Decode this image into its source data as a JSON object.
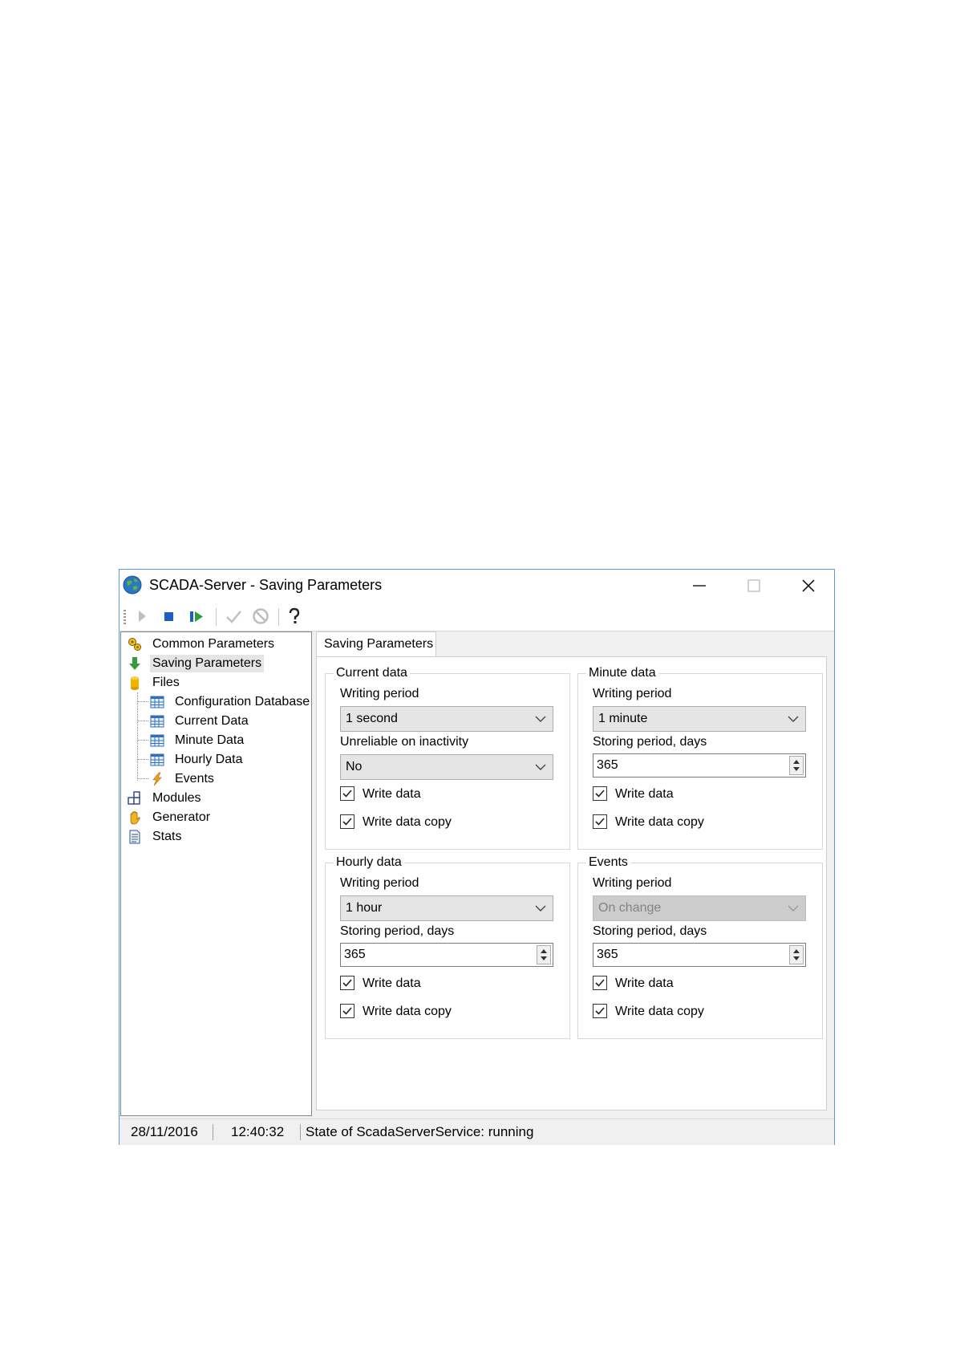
{
  "window": {
    "title": "SCADA-Server - Saving Parameters",
    "controls": {
      "minimize": "minimize-icon",
      "maximize": "maximize-icon",
      "close": "close-icon"
    }
  },
  "toolbar": {
    "buttons": [
      "start-icon",
      "stop-icon",
      "restart-icon",
      "apply-icon",
      "cancel-icon",
      "help-icon"
    ]
  },
  "tree": {
    "items": [
      {
        "label": "Common Parameters",
        "icon": "gears-icon"
      },
      {
        "label": "Saving Parameters",
        "icon": "download-arrow-icon",
        "selected": true
      },
      {
        "label": "Files",
        "icon": "database-icon"
      },
      {
        "label": "Configuration Database",
        "icon": "table-icon"
      },
      {
        "label": "Current Data",
        "icon": "table-icon"
      },
      {
        "label": "Minute Data",
        "icon": "table-icon"
      },
      {
        "label": "Hourly Data",
        "icon": "table-icon"
      },
      {
        "label": "Events",
        "icon": "lightning-icon"
      },
      {
        "label": "Modules",
        "icon": "modules-icon"
      },
      {
        "label": "Generator",
        "icon": "hand-icon"
      },
      {
        "label": "Stats",
        "icon": "document-icon"
      }
    ]
  },
  "tab": {
    "label": "Saving Parameters"
  },
  "groups": {
    "current": {
      "title": "Current data",
      "writing_period_label": "Writing period",
      "writing_period": "1 second",
      "unreliable_label": "Unreliable on inactivity",
      "unreliable": "No",
      "write_data": "Write data",
      "write_data_copy": "Write data copy"
    },
    "minute": {
      "title": "Minute data",
      "writing_period_label": "Writing period",
      "writing_period": "1 minute",
      "storing_label": "Storing period, days",
      "storing": "365",
      "write_data": "Write data",
      "write_data_copy": "Write data copy"
    },
    "hourly": {
      "title": "Hourly data",
      "writing_period_label": "Writing period",
      "writing_period": "1 hour",
      "storing_label": "Storing period, days",
      "storing": "365",
      "write_data": "Write data",
      "write_data_copy": "Write data copy"
    },
    "events": {
      "title": "Events",
      "writing_period_label": "Writing period",
      "writing_period": "On change",
      "storing_label": "Storing period, days",
      "storing": "365",
      "write_data": "Write data",
      "write_data_copy": "Write data copy"
    }
  },
  "statusbar": {
    "date": "28/11/2016",
    "time": "12:40:32",
    "state": "State of ScadaServerService: running"
  },
  "colors": {
    "window_border": "#5b9bd5",
    "selection": "#e5e5e5",
    "panel": "#f0f0f0"
  }
}
